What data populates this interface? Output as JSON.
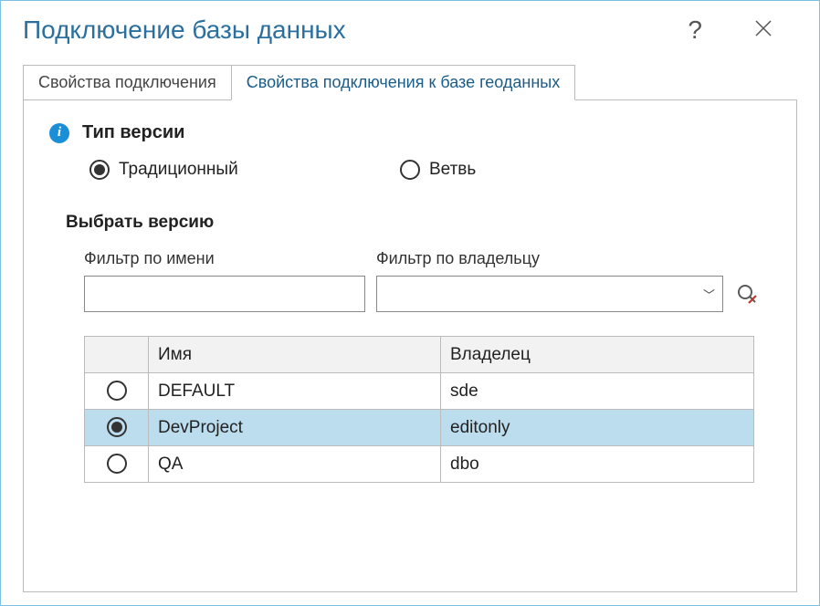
{
  "window": {
    "title": "Подключение базы данных"
  },
  "tabs": {
    "connection": "Свойства подключения",
    "geodb": "Свойства подключения к базе геоданных",
    "selected": "geodb"
  },
  "versionType": {
    "label": "Тип версии",
    "options": {
      "traditional": "Традиционный",
      "branch": "Ветвь"
    },
    "selected": "traditional"
  },
  "selectVersion": {
    "label": "Выбрать версию",
    "filterByName": {
      "label": "Фильтр по имени",
      "value": ""
    },
    "filterByOwner": {
      "label": "Фильтр по владельцу",
      "value": ""
    }
  },
  "table": {
    "columns": {
      "name": "Имя",
      "owner": "Владелец"
    },
    "rows": [
      {
        "name": "DEFAULT",
        "owner": "sde",
        "selected": false
      },
      {
        "name": "DevProject",
        "owner": "editonly",
        "selected": true
      },
      {
        "name": "QA",
        "owner": "dbo",
        "selected": false
      }
    ]
  }
}
